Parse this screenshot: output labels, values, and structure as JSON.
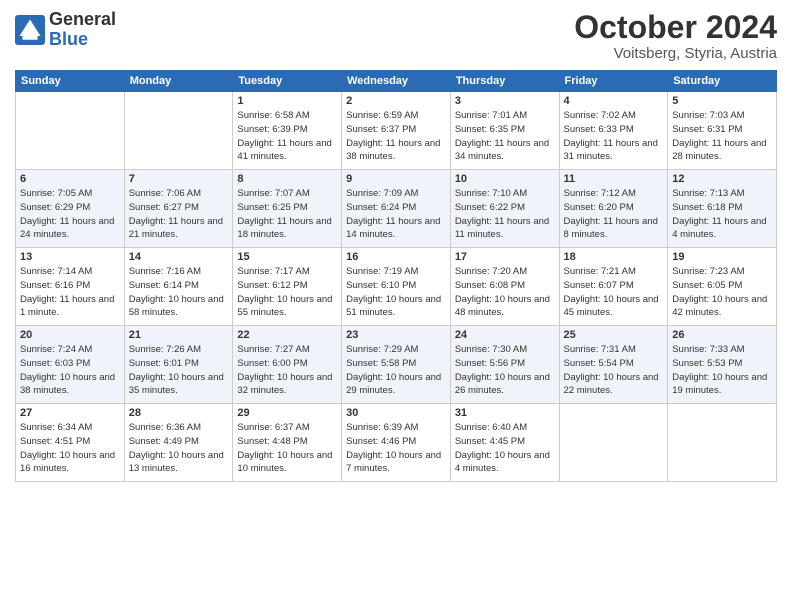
{
  "logo": {
    "general": "General",
    "blue": "Blue"
  },
  "header": {
    "month": "October 2024",
    "location": "Voitsberg, Styria, Austria"
  },
  "days_of_week": [
    "Sunday",
    "Monday",
    "Tuesday",
    "Wednesday",
    "Thursday",
    "Friday",
    "Saturday"
  ],
  "weeks": [
    [
      {
        "day": "",
        "info": ""
      },
      {
        "day": "",
        "info": ""
      },
      {
        "day": "1",
        "info": "Sunrise: 6:58 AM\nSunset: 6:39 PM\nDaylight: 11 hours and 41 minutes."
      },
      {
        "day": "2",
        "info": "Sunrise: 6:59 AM\nSunset: 6:37 PM\nDaylight: 11 hours and 38 minutes."
      },
      {
        "day": "3",
        "info": "Sunrise: 7:01 AM\nSunset: 6:35 PM\nDaylight: 11 hours and 34 minutes."
      },
      {
        "day": "4",
        "info": "Sunrise: 7:02 AM\nSunset: 6:33 PM\nDaylight: 11 hours and 31 minutes."
      },
      {
        "day": "5",
        "info": "Sunrise: 7:03 AM\nSunset: 6:31 PM\nDaylight: 11 hours and 28 minutes."
      }
    ],
    [
      {
        "day": "6",
        "info": "Sunrise: 7:05 AM\nSunset: 6:29 PM\nDaylight: 11 hours and 24 minutes."
      },
      {
        "day": "7",
        "info": "Sunrise: 7:06 AM\nSunset: 6:27 PM\nDaylight: 11 hours and 21 minutes."
      },
      {
        "day": "8",
        "info": "Sunrise: 7:07 AM\nSunset: 6:25 PM\nDaylight: 11 hours and 18 minutes."
      },
      {
        "day": "9",
        "info": "Sunrise: 7:09 AM\nSunset: 6:24 PM\nDaylight: 11 hours and 14 minutes."
      },
      {
        "day": "10",
        "info": "Sunrise: 7:10 AM\nSunset: 6:22 PM\nDaylight: 11 hours and 11 minutes."
      },
      {
        "day": "11",
        "info": "Sunrise: 7:12 AM\nSunset: 6:20 PM\nDaylight: 11 hours and 8 minutes."
      },
      {
        "day": "12",
        "info": "Sunrise: 7:13 AM\nSunset: 6:18 PM\nDaylight: 11 hours and 4 minutes."
      }
    ],
    [
      {
        "day": "13",
        "info": "Sunrise: 7:14 AM\nSunset: 6:16 PM\nDaylight: 11 hours and 1 minute."
      },
      {
        "day": "14",
        "info": "Sunrise: 7:16 AM\nSunset: 6:14 PM\nDaylight: 10 hours and 58 minutes."
      },
      {
        "day": "15",
        "info": "Sunrise: 7:17 AM\nSunset: 6:12 PM\nDaylight: 10 hours and 55 minutes."
      },
      {
        "day": "16",
        "info": "Sunrise: 7:19 AM\nSunset: 6:10 PM\nDaylight: 10 hours and 51 minutes."
      },
      {
        "day": "17",
        "info": "Sunrise: 7:20 AM\nSunset: 6:08 PM\nDaylight: 10 hours and 48 minutes."
      },
      {
        "day": "18",
        "info": "Sunrise: 7:21 AM\nSunset: 6:07 PM\nDaylight: 10 hours and 45 minutes."
      },
      {
        "day": "19",
        "info": "Sunrise: 7:23 AM\nSunset: 6:05 PM\nDaylight: 10 hours and 42 minutes."
      }
    ],
    [
      {
        "day": "20",
        "info": "Sunrise: 7:24 AM\nSunset: 6:03 PM\nDaylight: 10 hours and 38 minutes."
      },
      {
        "day": "21",
        "info": "Sunrise: 7:26 AM\nSunset: 6:01 PM\nDaylight: 10 hours and 35 minutes."
      },
      {
        "day": "22",
        "info": "Sunrise: 7:27 AM\nSunset: 6:00 PM\nDaylight: 10 hours and 32 minutes."
      },
      {
        "day": "23",
        "info": "Sunrise: 7:29 AM\nSunset: 5:58 PM\nDaylight: 10 hours and 29 minutes."
      },
      {
        "day": "24",
        "info": "Sunrise: 7:30 AM\nSunset: 5:56 PM\nDaylight: 10 hours and 26 minutes."
      },
      {
        "day": "25",
        "info": "Sunrise: 7:31 AM\nSunset: 5:54 PM\nDaylight: 10 hours and 22 minutes."
      },
      {
        "day": "26",
        "info": "Sunrise: 7:33 AM\nSunset: 5:53 PM\nDaylight: 10 hours and 19 minutes."
      }
    ],
    [
      {
        "day": "27",
        "info": "Sunrise: 6:34 AM\nSunset: 4:51 PM\nDaylight: 10 hours and 16 minutes."
      },
      {
        "day": "28",
        "info": "Sunrise: 6:36 AM\nSunset: 4:49 PM\nDaylight: 10 hours and 13 minutes."
      },
      {
        "day": "29",
        "info": "Sunrise: 6:37 AM\nSunset: 4:48 PM\nDaylight: 10 hours and 10 minutes."
      },
      {
        "day": "30",
        "info": "Sunrise: 6:39 AM\nSunset: 4:46 PM\nDaylight: 10 hours and 7 minutes."
      },
      {
        "day": "31",
        "info": "Sunrise: 6:40 AM\nSunset: 4:45 PM\nDaylight: 10 hours and 4 minutes."
      },
      {
        "day": "",
        "info": ""
      },
      {
        "day": "",
        "info": ""
      }
    ]
  ]
}
